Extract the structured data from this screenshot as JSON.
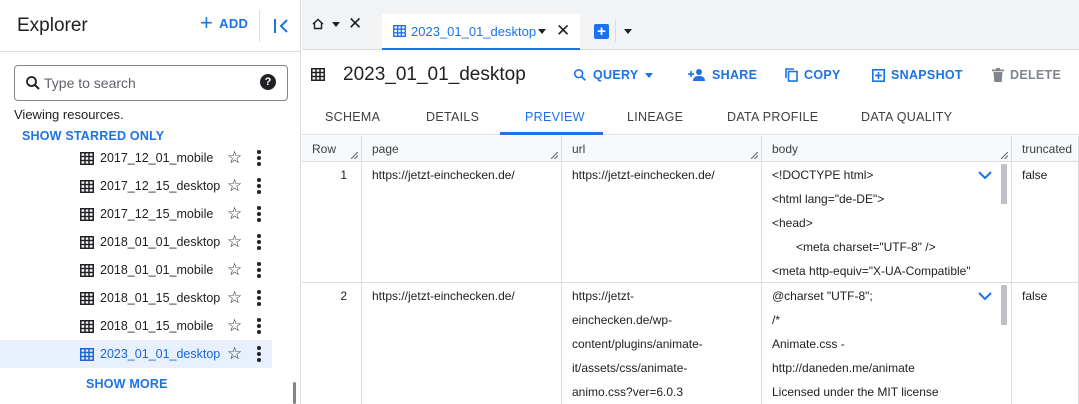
{
  "explorer": {
    "title": "Explorer",
    "add_label": "ADD",
    "search": {
      "placeholder": "Type to search",
      "value": ""
    },
    "viewing_text": "Viewing resources.",
    "starred_link": "SHOW STARRED ONLY",
    "tables": [
      {
        "name": "2017_12_01_mobile",
        "selected": false
      },
      {
        "name": "2017_12_15_desktop",
        "selected": false
      },
      {
        "name": "2017_12_15_mobile",
        "selected": false
      },
      {
        "name": "2018_01_01_desktop",
        "selected": false
      },
      {
        "name": "2018_01_01_mobile",
        "selected": false
      },
      {
        "name": "2018_01_15_desktop",
        "selected": false
      },
      {
        "name": "2018_01_15_mobile",
        "selected": false
      },
      {
        "name": "2023_01_01_desktop",
        "selected": true
      }
    ],
    "show_more": "SHOW MORE"
  },
  "tabs": {
    "active_label": "2023_01_01_desktop"
  },
  "table": {
    "title": "2023_01_01_desktop",
    "actions": {
      "query": "QUERY",
      "share": "SHARE",
      "copy": "COPY",
      "snapshot": "SNAPSHOT",
      "delete": "DELETE"
    },
    "subtabs": [
      "SCHEMA",
      "DETAILS",
      "PREVIEW",
      "LINEAGE",
      "DATA PROFILE",
      "DATA QUALITY"
    ],
    "active_subtab": "PREVIEW"
  },
  "grid": {
    "columns": [
      "Row",
      "page",
      "url",
      "body",
      "truncated"
    ],
    "rows": [
      {
        "row": "1",
        "page": "https://jetzt-einchecken.de/",
        "url": [
          "https://jetzt-einchecken.de/"
        ],
        "body": [
          "<!DOCTYPE html>",
          "<html lang=\"de-DE\">",
          "<head>",
          "<meta charset=\"UTF-8\" />",
          "<meta http-equiv=\"X-UA-Compatible\""
        ],
        "truncated": "false"
      },
      {
        "row": "2",
        "page": "https://jetzt-einchecken.de/",
        "url": [
          "https://jetzt-",
          "einchecken.de/wp-",
          "content/plugins/animate-",
          "it/assets/css/animate-",
          "animo.css?ver=6.0.3"
        ],
        "body": [
          "@charset \"UTF-8\";",
          "/*",
          "Animate.css -",
          "http://daneden.me/animate",
          "Licensed under the MIT license"
        ],
        "truncated": "false"
      }
    ]
  },
  "colors": {
    "accent": "#1a73e8",
    "selected_bg": "#e8f0fe",
    "border": "#dadce0",
    "tabbar_bg": "#f1f3f4"
  }
}
